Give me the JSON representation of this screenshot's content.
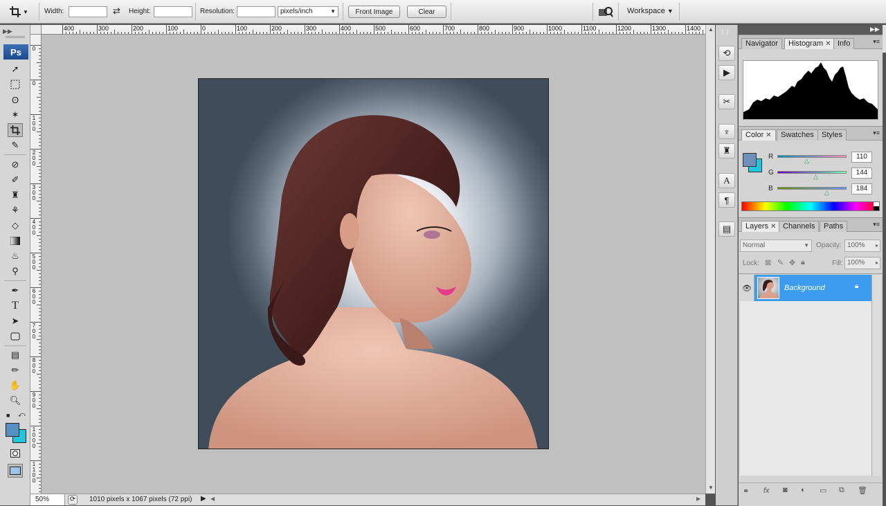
{
  "options_bar": {
    "width_label": "Width:",
    "width_value": "",
    "height_label": "Height:",
    "height_value": "",
    "resolution_label": "Resolution:",
    "resolution_value": "",
    "resolution_unit": "pixels/inch",
    "front_image_label": "Front Image",
    "clear_label": "Clear",
    "workspace_label": "Workspace"
  },
  "toolbox": {
    "logo": "Ps",
    "foreground_color": "#5790c2",
    "background_color": "#1fc6dc"
  },
  "ruler": {
    "top_labels": [
      "400",
      "300",
      "200",
      "100",
      "0",
      "100",
      "200",
      "300",
      "400",
      "500",
      "600",
      "700",
      "800",
      "900",
      "1000",
      "1100",
      "1200",
      "1300",
      "1400"
    ],
    "left_labels": [
      "0",
      "0",
      "1\n0\n0",
      "2\n0\n0",
      "3\n0\n0",
      "4\n0\n0",
      "5\n0\n0",
      "6\n0\n0",
      "7\n0\n0",
      "8\n0\n0",
      "9\n0\n0",
      "1\n0\n0\n0",
      "1\n1\n0\n0"
    ]
  },
  "status": {
    "zoom": "50%",
    "doc_info": "1010 pixels x 1067 pixels (72 ppi)"
  },
  "histogram_panel": {
    "tabs": [
      "Navigator",
      "Histogram",
      "Info"
    ]
  },
  "color_panel": {
    "tabs": [
      "Color",
      "Swatches",
      "Styles"
    ],
    "r_label": "R",
    "r_value": "110",
    "g_label": "G",
    "g_value": "144",
    "b_label": "B",
    "b_value": "184",
    "r_fraction": 0.43,
    "g_fraction": 0.56,
    "b_fraction": 0.72,
    "swatch_fg": "#6e90b8",
    "swatch_bg": "#1fc6dc"
  },
  "layers_panel": {
    "tabs": [
      "Layers",
      "Channels",
      "Paths"
    ],
    "blend_mode": "Normal",
    "opacity_label": "Opacity:",
    "opacity_value": "100%",
    "lock_label": "Lock:",
    "fill_label": "Fill:",
    "fill_value": "100%",
    "layer_name": "Background"
  }
}
